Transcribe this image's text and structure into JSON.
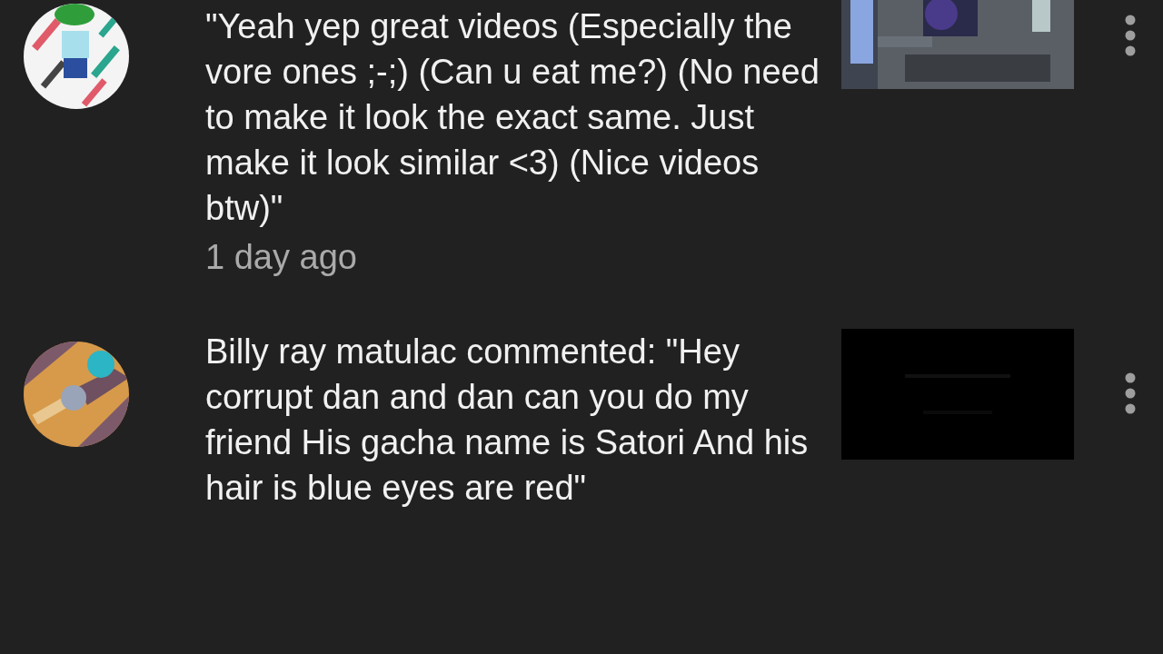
{
  "notifications": [
    {
      "message": "\"Yeah yep great videos (Especially the vore ones ;-;) (Can u eat me?) (No need to make it look the exact same. Just make it look similar <3) (Nice videos btw)\"",
      "time": "1 day ago"
    },
    {
      "message": "Billy ray matulac commented: \"Hey corrupt dan and dan can you do my friend His gacha name is Satori And his hair is blue eyes are red\""
    }
  ]
}
